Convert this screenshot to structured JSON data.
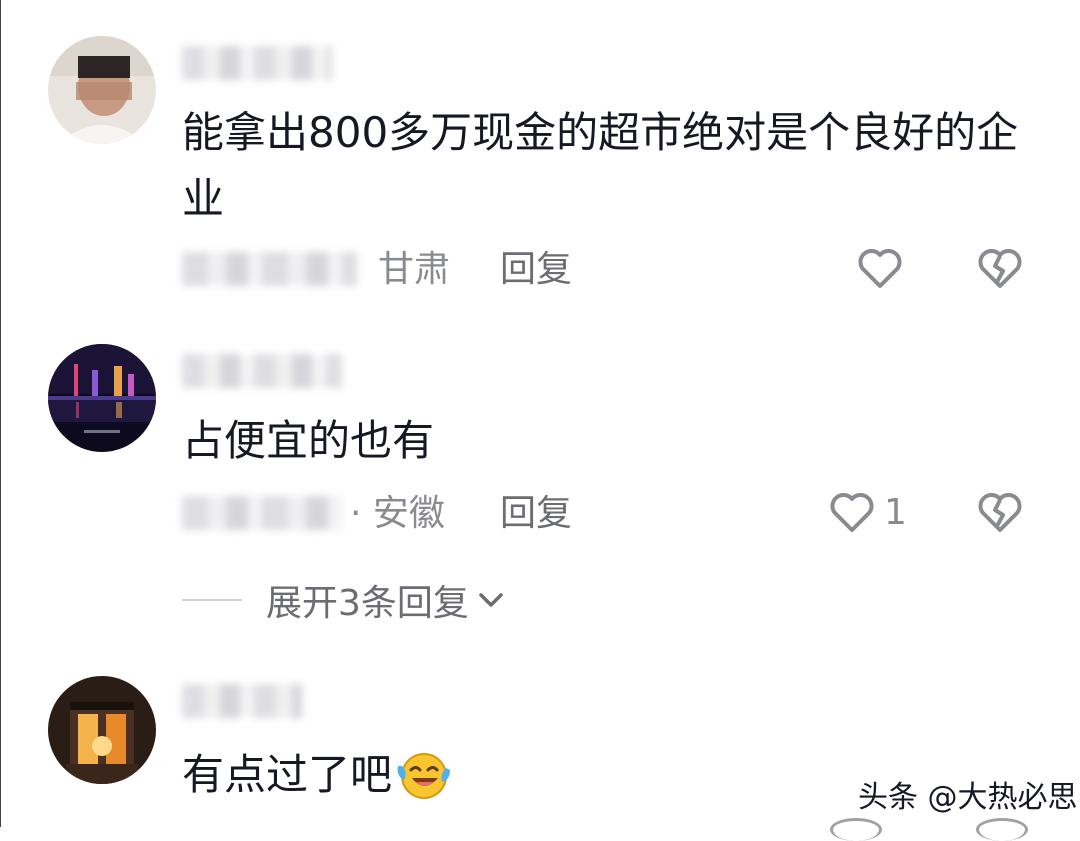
{
  "comments": [
    {
      "text": "能拿出800多万现金的超市绝对是个良好的企业",
      "region": "甘肃",
      "reply_label": "回复",
      "likes": ""
    },
    {
      "text": "占便宜的也有",
      "region": "· 安徽",
      "reply_label": "回复",
      "likes": "1"
    },
    {
      "text": "有点过了吧"
    }
  ],
  "expand_label": "展开3条回复",
  "watermark": "头条 @大热必思",
  "icons": {
    "like": "heart-outline-icon",
    "dislike": "broken-heart-icon",
    "expand": "chevron-down-icon",
    "emoji": "laughing-tears-emoji-icon"
  },
  "colors": {
    "text": "#161823",
    "secondary": "#8a8b91",
    "icon": "#8a8b91"
  }
}
